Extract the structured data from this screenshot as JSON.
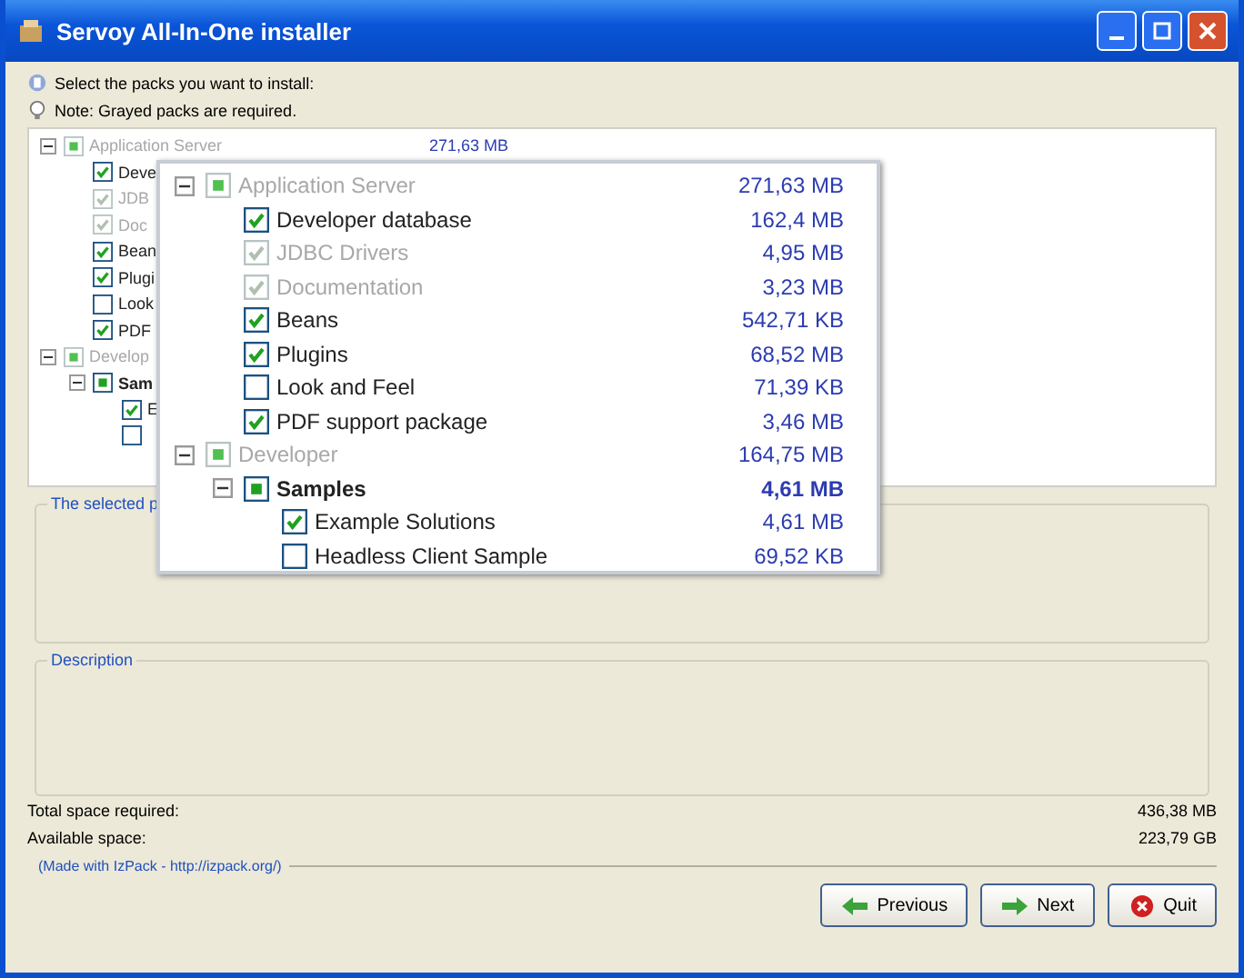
{
  "window": {
    "title": "Servoy All-In-One installer"
  },
  "messages": [
    {
      "kind": "info",
      "text": "Select the packs you want to install:"
    },
    {
      "kind": "note",
      "text": "Note: Grayed packs are required."
    }
  ],
  "pack_tree": [
    {
      "kind": "group",
      "label": "Application Server",
      "size": "271,63 MB",
      "disabled": true,
      "expanded": true,
      "children": [
        {
          "kind": "item",
          "label": "Deve",
          "checked": true,
          "disabled": false
        },
        {
          "kind": "item",
          "label": "JDB",
          "checked": true,
          "disabled": true
        },
        {
          "kind": "item",
          "label": "Doc",
          "checked": true,
          "disabled": true
        },
        {
          "kind": "item",
          "label": "Bean",
          "checked": true,
          "disabled": false
        },
        {
          "kind": "item",
          "label": "Plugi",
          "checked": true,
          "disabled": false
        },
        {
          "kind": "item",
          "label": "Look",
          "checked": false,
          "disabled": false
        },
        {
          "kind": "item",
          "label": "PDF",
          "checked": true,
          "disabled": false
        }
      ]
    },
    {
      "kind": "group",
      "label": "Develop",
      "disabled": true,
      "expanded": true,
      "children": [
        {
          "kind": "group",
          "label": "Sam",
          "disabled": false,
          "expanded": true,
          "children": [
            {
              "kind": "item",
              "label": "E",
              "checked": true,
              "disabled": false
            },
            {
              "kind": "item",
              "checked": false,
              "disabled": false
            }
          ]
        }
      ]
    }
  ],
  "zoom_tree": [
    {
      "kind": "group",
      "label": "Application Server",
      "size": "271,63 MB",
      "disabled": true,
      "expanded": true,
      "children": [
        {
          "kind": "item",
          "label": "Developer database",
          "size": "162,4 MB",
          "checked": true,
          "disabled": false
        },
        {
          "kind": "item",
          "label": "JDBC Drivers",
          "size": "4,95 MB",
          "checked": true,
          "disabled": true
        },
        {
          "kind": "item",
          "label": "Documentation",
          "size": "3,23 MB",
          "checked": true,
          "disabled": true
        },
        {
          "kind": "item",
          "label": "Beans",
          "size": "542,71 KB",
          "checked": true,
          "disabled": false
        },
        {
          "kind": "item",
          "label": "Plugins",
          "size": "68,52 MB",
          "checked": true,
          "disabled": false
        },
        {
          "kind": "item",
          "label": "Look and Feel",
          "size": "71,39 KB",
          "checked": false,
          "disabled": false
        },
        {
          "kind": "item",
          "label": "PDF support package",
          "size": "3,46 MB",
          "checked": true,
          "disabled": false
        }
      ]
    },
    {
      "kind": "group",
      "label": "Developer",
      "size": "164,75 MB",
      "disabled": true,
      "expanded": true,
      "children": [
        {
          "kind": "group",
          "label": "Samples",
          "size": "4,61 MB",
          "disabled": false,
          "expanded": true,
          "children": [
            {
              "kind": "item",
              "label": "Example Solutions",
              "size": "4,61 MB",
              "checked": true,
              "disabled": false
            },
            {
              "kind": "item",
              "label": "Headless Client Sample",
              "size": "69,52 KB",
              "checked": false,
              "disabled": false
            }
          ]
        }
      ]
    }
  ],
  "selected_panel": {
    "title": "The selected p"
  },
  "description_panel": {
    "title": "Description"
  },
  "totals": [
    {
      "label": "Total space required:",
      "value": "436,38 MB"
    },
    {
      "label": "Available space:",
      "value": "223,79 GB"
    }
  ],
  "credit": "(Made with IzPack - http://izpack.org/)",
  "buttons": [
    {
      "kind": "previous",
      "label": "Previous"
    },
    {
      "kind": "next",
      "label": "Next"
    },
    {
      "kind": "quit",
      "label": "Quit"
    }
  ]
}
